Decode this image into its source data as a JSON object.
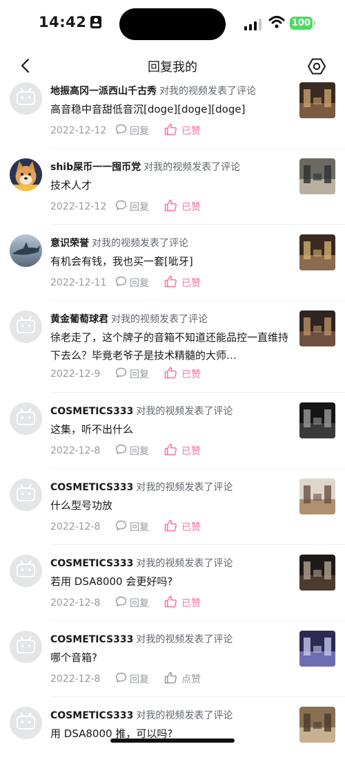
{
  "status_bar": {
    "time": "14:42",
    "battery": "100"
  },
  "header": {
    "title": "回复我的"
  },
  "colors": {
    "accent": "#fb7299",
    "muted": "#9499a0",
    "text": "#18191c"
  },
  "items": [
    {
      "user": "地振高冈一派西山千古秀",
      "action": "对我的视频发表了评论",
      "content": "高音稳中音甜低音沉[doge][doge][doge]",
      "date": "2022-12-12",
      "reply": "回复",
      "like": "已赞",
      "liked": true,
      "avatar": "default-avatar-icon"
    },
    {
      "user": "shib屎币一一囤币党",
      "action": "对我的视频发表了评论",
      "content": "技术人才",
      "date": "2022-12-12",
      "reply": "回复",
      "like": "已赞",
      "liked": true,
      "avatar": "shiba-avatar"
    },
    {
      "user": "意识荣誉",
      "action": "对我的视频发表了评论",
      "content": "有机会有钱，我也买一套[呲牙]",
      "date": "2022-12-11",
      "reply": "回复",
      "like": "已赞",
      "liked": true,
      "avatar": "shark-avatar"
    },
    {
      "user": "黄金葡萄球君",
      "action": "对我的视频发表了评论",
      "content": "徐老走了，这个牌子的音箱不知道还能品控一直维持下去么？毕竟老爷子是技术精髓的大师…",
      "date": "2022-12-9",
      "reply": "回复",
      "like": "已赞",
      "liked": true,
      "avatar": "default-avatar-icon"
    },
    {
      "user": "COSMETICS333",
      "action": "对我的视频发表了评论",
      "content": "这集，听不出什么",
      "date": "2022-12-8",
      "reply": "回复",
      "like": "已赞",
      "liked": true,
      "avatar": "default-avatar-icon"
    },
    {
      "user": "COSMETICS333",
      "action": "对我的视频发表了评论",
      "content": "什么型号功放",
      "date": "2022-12-8",
      "reply": "回复",
      "like": "已赞",
      "liked": true,
      "avatar": "default-avatar-icon"
    },
    {
      "user": "COSMETICS333",
      "action": "对我的视频发表了评论",
      "content": "若用 DSA8000 会更好吗?",
      "date": "2022-12-8",
      "reply": "回复",
      "like": "已赞",
      "liked": true,
      "avatar": "default-avatar-icon"
    },
    {
      "user": "COSMETICS333",
      "action": "对我的视频发表了评论",
      "content": "哪个音箱?",
      "date": "2022-12-8",
      "reply": "回复",
      "like": "点赞",
      "liked": false,
      "avatar": "default-avatar-icon"
    },
    {
      "user": "COSMETICS333",
      "action": "对我的视频发表了评论",
      "content": "用 DSA8000 推，可以吗?",
      "date": "",
      "reply": "",
      "like": "",
      "liked": false,
      "avatar": "default-avatar-icon"
    }
  ]
}
